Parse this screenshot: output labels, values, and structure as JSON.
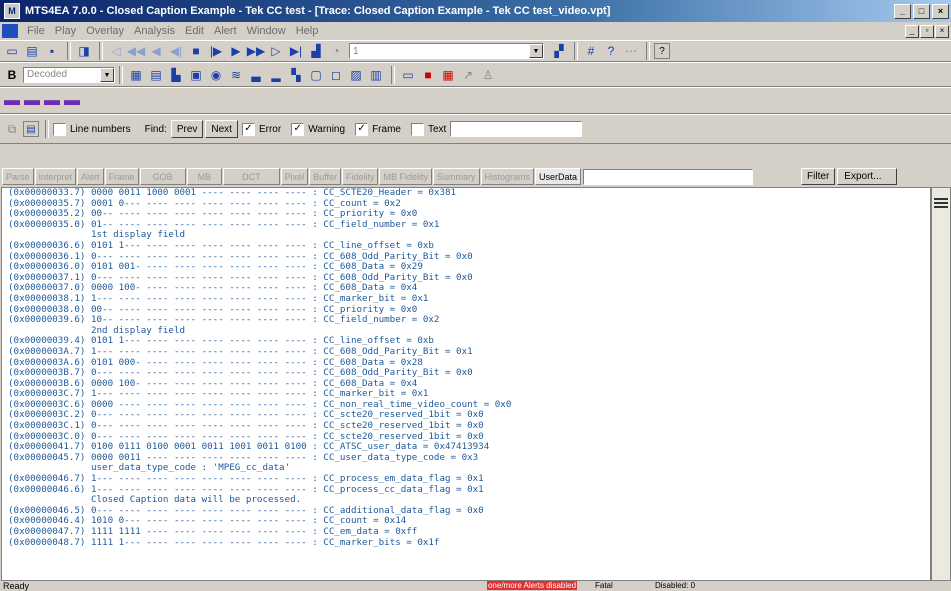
{
  "window": {
    "title": "MTS4EA 7.0.0 - Closed Caption Example - Tek CC test - [Trace: Closed Caption Example - Tek CC test_video.vpt]",
    "app_icon": "mts-app-icon"
  },
  "menu": [
    "File",
    "Play",
    "Overlay",
    "Analysis",
    "Edit",
    "Alert",
    "Window",
    "Help"
  ],
  "toolbar": {
    "program_combo_value": "1",
    "view_combo_value": "Decoded"
  },
  "filterbar": {
    "line_numbers_label": "Line numbers",
    "line_numbers_checked": false,
    "find_label": "Find:",
    "prev_label": "Prev",
    "next_label": "Next",
    "error_label": "Error",
    "error_checked": true,
    "warning_label": "Warning",
    "warning_checked": true,
    "frame_label": "Frame",
    "frame_checked": true,
    "text_label": "Text",
    "text_checked": false,
    "text_value": ""
  },
  "tabs": [
    {
      "label": "Parse",
      "active": false
    },
    {
      "label": "Interpret",
      "active": false
    },
    {
      "label": "Alert",
      "active": false
    },
    {
      "label": "Frame",
      "active": false
    },
    {
      "label": "GOB",
      "active": false
    },
    {
      "label": "MB",
      "active": false
    },
    {
      "label": "DCT",
      "active": false
    },
    {
      "label": "Pixel",
      "active": false
    },
    {
      "label": "Buffer",
      "active": false
    },
    {
      "label": "Fidelity",
      "active": false
    },
    {
      "label": "MB Fidelity",
      "active": false
    },
    {
      "label": "Summary",
      "active": false
    },
    {
      "label": "Histograms",
      "active": false
    },
    {
      "label": "UserData",
      "active": true
    }
  ],
  "filter_input_value": "",
  "filter_button_label": "Filter",
  "export_button_label": "Export...",
  "trace_lines": [
    "(0x00000033.7) 0000 0011 1000 0001 ---- ---- ---- ---- : CC_SCTE20_Header = 0x381",
    "(0x00000035.7) 0001 0--- ---- ---- ---- ---- ---- ---- : CC_count = 0x2",
    "(0x00000035.2) 00-- ---- ---- ---- ---- ---- ---- ---- : CC_priority = 0x0",
    "(0x00000035.0) 01-- ---- ---- ---- ---- ---- ---- ---- : CC_field_number = 0x1",
    "               1st display field",
    "(0x00000036.6) 0101 1--- ---- ---- ---- ---- ---- ---- : CC_line_offset = 0xb",
    "(0x00000036.1) 0--- ---- ---- ---- ---- ---- ---- ---- : CC_608_Odd_Parity_Bit = 0x0",
    "(0x00000036.0) 0101 001- ---- ---- ---- ---- ---- ---- : CC_608_Data = 0x29",
    "(0x00000037.1) 0--- ---- ---- ---- ---- ---- ---- ---- : CC_608_Odd_Parity_Bit = 0x0",
    "(0x00000037.0) 0000 100- ---- ---- ---- ---- ---- ---- : CC_608_Data = 0x4",
    "(0x00000038.1) 1--- ---- ---- ---- ---- ---- ---- ---- : CC_marker_bit = 0x1",
    "(0x00000038.0) 00-- ---- ---- ---- ---- ---- ---- ---- : CC_priority = 0x0",
    "(0x00000039.6) 10-- ---- ---- ---- ---- ---- ---- ---- : CC_field_number = 0x2",
    "               2nd display field",
    "(0x00000039.4) 0101 1--- ---- ---- ---- ---- ---- ---- : CC_line_offset = 0xb",
    "(0x0000003A.7) 1--- ---- ---- ---- ---- ---- ---- ---- : CC_608_Odd_Parity_Bit = 0x1",
    "(0x0000003A.6) 0101 000- ---- ---- ---- ---- ---- ---- : CC_608_Data = 0x28",
    "(0x0000003B.7) 0--- ---- ---- ---- ---- ---- ---- ---- : CC_608_Odd_Parity_Bit = 0x0",
    "(0x0000003B.6) 0000 100- ---- ---- ---- ---- ---- ---- : CC_608_Data = 0x4",
    "(0x0000003C.7) 1--- ---- ---- ---- ---- ---- ---- ---- : CC_marker_bit = 0x1",
    "(0x0000003C.6) 0000 ---- ---- ---- ---- ---- ---- ---- : CC_non_real_time_video_count = 0x0",
    "(0x0000003C.2) 0--- ---- ---- ---- ---- ---- ---- ---- : CC_scte20_reserved_1bit = 0x0",
    "(0x0000003C.1) 0--- ---- ---- ---- ---- ---- ---- ---- : CC_scte20_reserved_1bit = 0x0",
    "(0x0000003C.0) 0--- ---- ---- ---- ---- ---- ---- ---- : CC_scte20_reserved_1bit = 0x0",
    "(0x00000041.7) 0100 0111 0100 0001 0011 1001 0011 0100 : CC_ATSC_user_data = 0x47413934",
    "(0x00000045.7) 0000 0011 ---- ---- ---- ---- ---- ---- : CC_user_data_type_code = 0x3",
    "               user_data_type_code : 'MPEG_cc_data'",
    "(0x00000046.7) 1--- ---- ---- ---- ---- ---- ---- ---- : CC_process_em_data_flag = 0x1",
    "(0x00000046.6) 1--- ---- ---- ---- ---- ---- ---- ---- : CC_process_cc_data_flag = 0x1",
    "               Closed Caption data will be processed.",
    "(0x00000046.5) 0--- ---- ---- ---- ---- ---- ---- ---- : CC_additional_data_flag = 0x0",
    "(0x00000046.4) 1010 0--- ---- ---- ---- ---- ---- ---- : CC_count = 0x14",
    "(0x00000047.7) 1111 1111 ---- ---- ---- ---- ---- ---- : CC_em_data = 0xff",
    "(0x00000048.7) 1111 1--- ---- ---- ---- ---- ---- ---- : CC_marker_bits = 0x1f"
  ],
  "status": {
    "ready": "Ready",
    "alerts": "one/more Alerts disabled",
    "alerts_color": "#e03030",
    "fatal": "Fatal",
    "disabled": "Disabled: 0"
  }
}
